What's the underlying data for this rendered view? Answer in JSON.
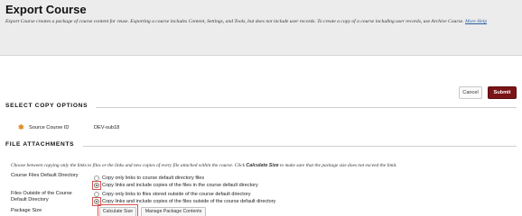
{
  "header": {
    "title": "Export Course",
    "description": "Export Course creates a package of course content for reuse. Exporting a course includes Content, Settings, and Tools, but does not include user records. To create a copy of a course including user records, use Archive Course.",
    "help_link": "More Help"
  },
  "actions": {
    "cancel_label": "Cancel",
    "submit_label": "Submit"
  },
  "select_copy_options": {
    "title": "SELECT COPY OPTIONS",
    "source_course_id_label": "Source Course ID",
    "source_course_id_value": "DEV-sub18"
  },
  "file_attachments": {
    "title": "FILE ATTACHMENTS",
    "instruction_before": "Choose between copying only the links to files or the links and new copies of every file attached within the course. Click ",
    "instruction_bold": "Calculate Size",
    "instruction_after": " to make sure that the package size does not exceed the limit.",
    "course_files_label": "Course Files Default Directory",
    "course_files_options": [
      "Copy only links to course default directory files",
      "Copy links and include copies of the files in the course default directory"
    ],
    "course_files_selected": 1,
    "outside_files_label_line1": "Files Outside of the Course",
    "outside_files_label_line2": "Default Directory",
    "outside_files_options": [
      "Copy only links to files stored outside of the course default directory",
      "Copy links and include copies of the files outside of the course default directory"
    ],
    "outside_files_selected": 1,
    "package_size_label": "Package Size",
    "calculate_size_label": "Calculate Size",
    "manage_package_label": "Manage Package Contents"
  },
  "colors": {
    "submit_bg": "#7a1416",
    "highlight": "#d9534f",
    "required_star": "#e58a1e"
  }
}
